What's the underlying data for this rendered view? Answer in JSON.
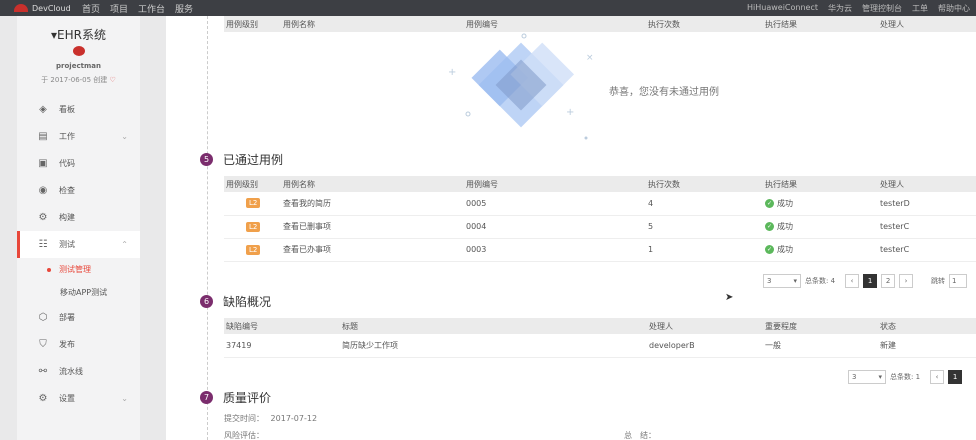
{
  "topbar": {
    "logo": "DevCloud",
    "nav": [
      "首页",
      "项目",
      "工作台",
      "服务"
    ],
    "right": [
      "HiHuaweiConnect",
      "华为云",
      "管理控制台",
      "工单",
      "帮助中心"
    ]
  },
  "sidebar": {
    "project_name": "EHR系统",
    "owner": "projectman",
    "created": "于 2017-06-05 创建",
    "menu": [
      {
        "label": "看板",
        "icon": "dashboard-icon",
        "glyph": "◈"
      },
      {
        "label": "工作",
        "icon": "document-icon",
        "glyph": "▤",
        "chev": "⌄"
      },
      {
        "label": "代码",
        "icon": "code-icon",
        "glyph": "▣"
      },
      {
        "label": "检查",
        "icon": "check-icon",
        "glyph": "◉"
      },
      {
        "label": "构建",
        "icon": "gear-icon",
        "glyph": "⚙"
      },
      {
        "label": "测试",
        "icon": "test-icon",
        "glyph": "☷",
        "chev": "⌃"
      },
      {
        "label": "部署",
        "icon": "cube-icon",
        "glyph": "⬡"
      },
      {
        "label": "发布",
        "icon": "shield-icon",
        "glyph": "⛉"
      },
      {
        "label": "流水线",
        "icon": "pipeline-icon",
        "glyph": "⚯"
      },
      {
        "label": "设置",
        "icon": "settings-icon",
        "glyph": "⚙",
        "chev": "⌄"
      }
    ],
    "submenu": [
      {
        "label": "测试管理",
        "active": true
      },
      {
        "label": "移动APP测试",
        "active": false
      }
    ]
  },
  "failed_table": {
    "headers": [
      "用例级别",
      "用例名称",
      "用例编号",
      "执行次数",
      "执行结果",
      "处理人"
    ],
    "empty_message": "恭喜，您没有未通过用例"
  },
  "passed": {
    "number": "5",
    "title": "已通过用例",
    "headers": [
      "用例级别",
      "用例名称",
      "用例编号",
      "执行次数",
      "执行结果",
      "处理人"
    ],
    "rows": [
      {
        "level": "L2",
        "name": "查看我的简历",
        "id": "0005",
        "count": "4",
        "result": "成功",
        "owner": "testerD"
      },
      {
        "level": "L2",
        "name": "查看已删事项",
        "id": "0004",
        "count": "5",
        "result": "成功",
        "owner": "testerC"
      },
      {
        "level": "L2",
        "name": "查看已办事项",
        "id": "0003",
        "count": "1",
        "result": "成功",
        "owner": "testerC"
      }
    ],
    "pager": {
      "size": "3",
      "total": "总条数: 4",
      "pages": [
        "1",
        "2"
      ],
      "jump_label": "跳转",
      "jump_value": "1"
    }
  },
  "defects": {
    "number": "6",
    "title": "缺陷概况",
    "headers": [
      "缺陷编号",
      "标题",
      "处理人",
      "重要程度",
      "状态"
    ],
    "rows": [
      {
        "id": "37419",
        "title": "简历缺少工作项",
        "owner": "developerB",
        "severity": "一般",
        "status": "新建"
      }
    ],
    "pager": {
      "size": "3",
      "total": "总条数: 1",
      "pages": [
        "1"
      ]
    }
  },
  "quality": {
    "number": "7",
    "title": "质量评价",
    "submit_label": "提交时间：",
    "submit_time": "2017-07-12",
    "risk_label": "风险评估：",
    "summary_label": "总　结："
  },
  "colors": {
    "accent": "#e8473a",
    "section_num": "#7b2d6d",
    "success": "#5cb85c",
    "level_badge": "#f0a04b"
  }
}
